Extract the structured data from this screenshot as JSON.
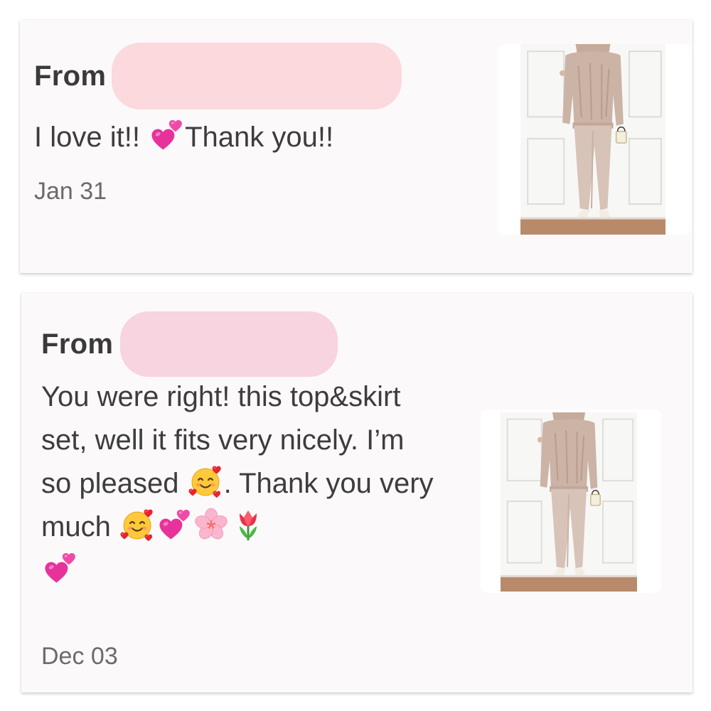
{
  "reviews": [
    {
      "from_label": "From",
      "message_parts": [
        {
          "text": "I love it!! "
        },
        {
          "emoji": "two-hearts-icon"
        },
        {
          "text": "Thank you!!"
        }
      ],
      "date": "Jan 31",
      "photo": "product-photo-outfit"
    },
    {
      "from_label": "From",
      "message_parts": [
        {
          "text": "You were right! this top&skirt set, well it fits very nicely. I’m so pleased "
        },
        {
          "emoji": "smiling-face-with-hearts-icon"
        },
        {
          "text": ". Thank you very much "
        },
        {
          "emoji": "smiling-face-with-hearts-icon"
        },
        {
          "emoji": "two-hearts-icon"
        },
        {
          "emoji": "cherry-blossom-icon"
        },
        {
          "emoji": "tulip-icon"
        },
        {
          "emoji": "two-hearts-icon"
        }
      ],
      "date": "Dec 03",
      "photo": "product-photo-outfit"
    }
  ],
  "colors": {
    "card_background": "#fcf9fa",
    "redaction_card1": "#fbd9dc",
    "redaction_card2": "#f8d3e0",
    "text": "#3d3d3d",
    "date_text": "#6b6b6b"
  }
}
